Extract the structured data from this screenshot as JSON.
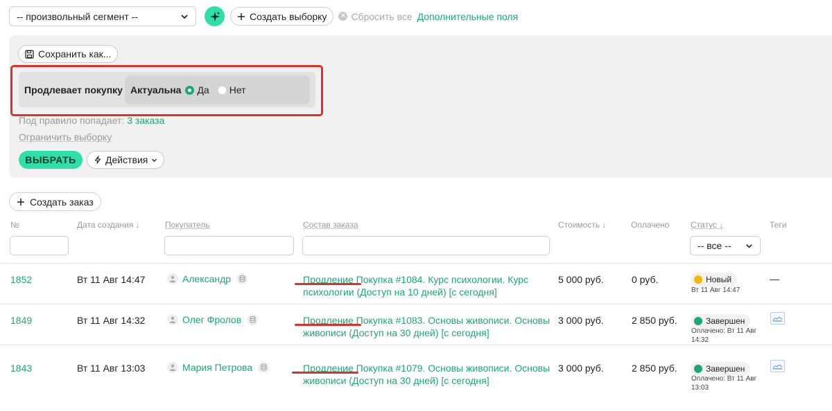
{
  "topbar": {
    "segment": "-- произвольный сегмент --",
    "magic_icon": "sparkles-icon",
    "create_selection": "Создать выборку",
    "reset_all": "Сбросить все",
    "extra_fields": "Дополнительные поля"
  },
  "filter": {
    "save_as": "Сохранить как...",
    "rule_label": "Продлевает покупку",
    "actual_label": "Актуальна",
    "option_yes": "Да",
    "option_no": "Нет",
    "selected": "Да",
    "match_prefix": "Под правило попадает:",
    "match_count": "3 заказа",
    "limit_selection": "Ограничить выборку",
    "select_button": "ВЫБРАТЬ",
    "actions_button": "Действия"
  },
  "create_order": "Создать заказ",
  "table": {
    "headers": {
      "number": "№",
      "created": "Дата создания ↓",
      "buyer": "Покупатель",
      "composition": "Состав заказа",
      "cost": "Стоимость ↓",
      "paid": "Оплачено",
      "status": "Статус ↓",
      "tags": "Теги"
    },
    "status_filter": "-- все --",
    "rows": [
      {
        "number": "1852",
        "created": "Вт 11 Авг 14:47",
        "buyer": "Александр",
        "composition": "Продление Покупка #1084. Курс психологии. Курс психологии (Доступ на 10 дней) [с сегодня]",
        "cost": "5 000 руб.",
        "paid": "0 руб.",
        "status": "Новый",
        "status_color": "#f5b800",
        "status_sub": "Вт 11 Авг 14:47",
        "tags": "—"
      },
      {
        "number": "1849",
        "created": "Вт 11 Авг 14:32",
        "buyer": "Олег Фролов",
        "composition": "Продление Покупка #1083. Основы живописи. Основы живописи (Доступ на 30 дней) [с сегодня]",
        "cost": "3 000 руб.",
        "paid": "2 850 руб.",
        "status": "Завершен",
        "status_color": "#1aa874",
        "status_sub": "Оплачено: Вт 11 Авг 14:32",
        "tags": ""
      },
      {
        "number": "1843",
        "created": "Вт 11 Авг 13:03",
        "buyer": "Мария Петрова",
        "composition": "Продление Покупка #1079. Основы живописи. Основы живописи (Доступ на 30 дней) [с сегодня]",
        "cost": "3 000 руб.",
        "paid": "2 850 руб.",
        "status": "Завершен",
        "status_color": "#1aa874",
        "status_sub": "Оплачено: Вт 11 Авг 13:03",
        "tags": ""
      }
    ]
  }
}
